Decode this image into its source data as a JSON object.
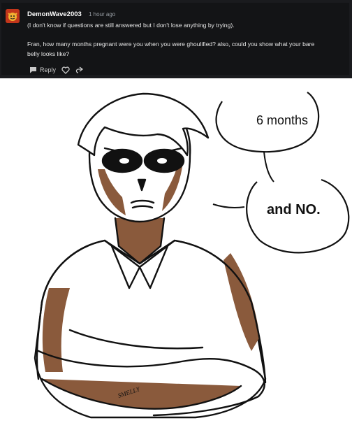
{
  "comment": {
    "username": "DemonWave2003",
    "timestamp": "1 hour ago",
    "lines": [
      "(I don't know if questions are still answered but I don't lose anything by trying).",
      "Fran, how many months pregnant were you when you were ghoulified? also, could you show what your bare",
      "belly looks like?"
    ],
    "actions": {
      "reply_label": "Reply"
    }
  },
  "illustration": {
    "bubble_1": "6 months",
    "bubble_2": "and NO.",
    "signature": "SMELLY"
  },
  "colors": {
    "card_bg": "#131416",
    "avatar": "#c2361b",
    "skin_shade": "#8a5a3c"
  }
}
